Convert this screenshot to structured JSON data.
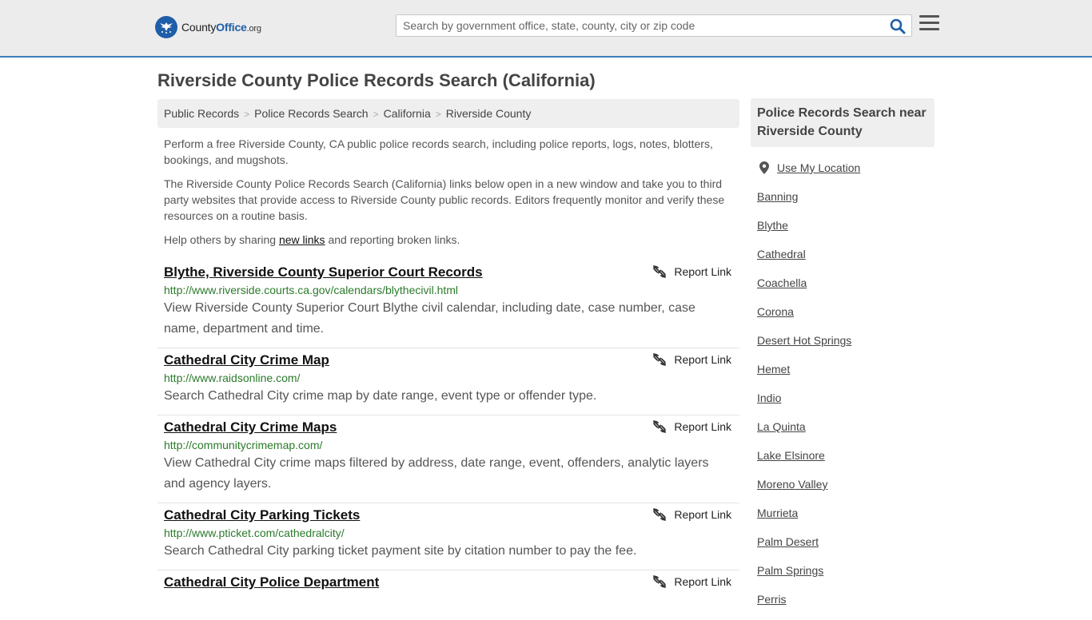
{
  "header": {
    "logo_county": "County",
    "logo_office": "Office",
    "logo_org": ".org",
    "search_placeholder": "Search by government office, state, county, city or zip code"
  },
  "page_title": "Riverside County Police Records Search (California)",
  "breadcrumb": [
    "Public Records",
    "Police Records Search",
    "California",
    "Riverside County"
  ],
  "intro": {
    "p1": "Perform a free Riverside County, CA public police records search, including police reports, logs, notes, blotters, bookings, and mugshots.",
    "p2": "The Riverside County Police Records Search (California) links below open in a new window and take you to third party websites that provide access to Riverside County public records. Editors frequently monitor and verify these resources on a routine basis.",
    "p3_before": "Help others by sharing ",
    "p3_link": "new links",
    "p3_after": " and reporting broken links."
  },
  "report_label": "Report Link",
  "results": [
    {
      "title": "Blythe, Riverside County Superior Court Records",
      "url": "http://www.riverside.courts.ca.gov/calendars/blythecivil.html",
      "desc": "View Riverside County Superior Court Blythe civil calendar, including date, case number, case name, department and time."
    },
    {
      "title": "Cathedral City Crime Map",
      "url": "http://www.raidsonline.com/",
      "desc": "Search Cathedral City crime map by date range, event type or offender type."
    },
    {
      "title": "Cathedral City Crime Maps",
      "url": "http://communitycrimemap.com/",
      "desc": "View Cathedral City crime maps filtered by address, date range, event, offenders, analytic layers and agency layers."
    },
    {
      "title": "Cathedral City Parking Tickets",
      "url": "http://www.pticket.com/cathedralcity/",
      "desc": "Search Cathedral City parking ticket payment site by citation number to pay the fee."
    },
    {
      "title": "Cathedral City Police Department",
      "url": "",
      "desc": ""
    }
  ],
  "sidebar": {
    "heading": "Police Records Search near Riverside County",
    "use_location": "Use My Location",
    "cities": [
      "Banning",
      "Blythe",
      "Cathedral",
      "Coachella",
      "Corona",
      "Desert Hot Springs",
      "Hemet",
      "Indio",
      "La Quinta",
      "Lake Elsinore",
      "Moreno Valley",
      "Murrieta",
      "Palm Desert",
      "Palm Springs",
      "Perris"
    ]
  }
}
